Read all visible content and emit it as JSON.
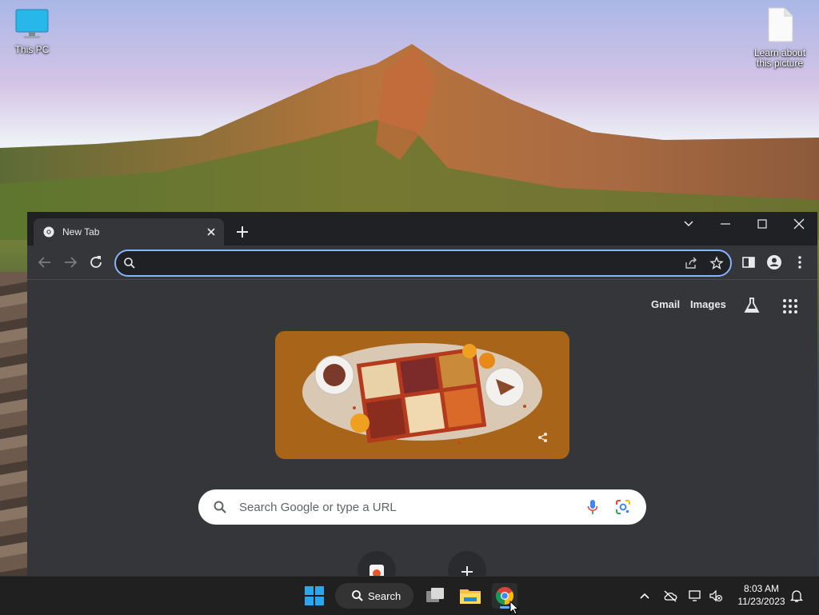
{
  "desktop": {
    "icons": [
      {
        "label": "This PC",
        "icon": "monitor-icon"
      },
      {
        "label": "Learn about this picture",
        "icon": "document-icon"
      }
    ]
  },
  "browser": {
    "tab": {
      "title": "New Tab"
    },
    "omnibox": {
      "value": "",
      "placeholder": ""
    },
    "newtab_page": {
      "links": {
        "gmail": "Gmail",
        "images": "Images"
      },
      "search_placeholder": "Search Google or type a URL"
    }
  },
  "taskbar": {
    "search_label": "Search",
    "clock": {
      "time": "8:03 AM",
      "date": "11/23/2023"
    }
  },
  "colors": {
    "accent": "#8ab4f8",
    "doodle_bg": "#a8651a",
    "window_bg": "#35363a",
    "tabstrip_bg": "#202124"
  }
}
